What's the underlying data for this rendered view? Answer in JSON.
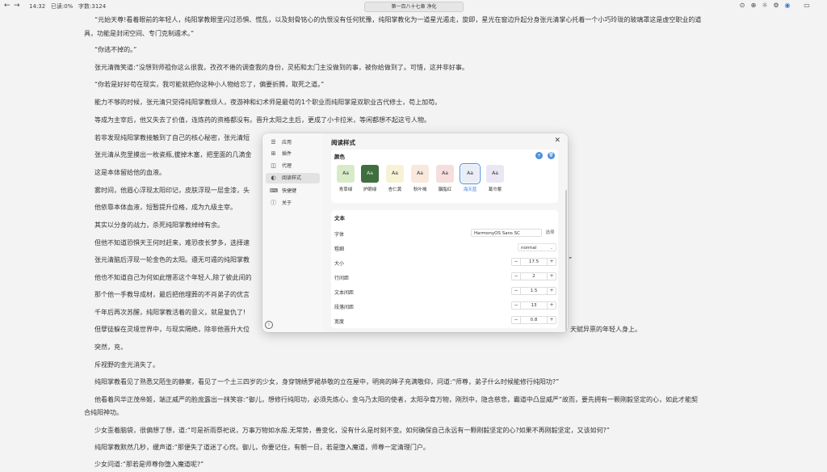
{
  "topbar": {
    "time": "14:32",
    "read_progress": "已读:0%",
    "word_count": "字数:3124",
    "chapter": "第一百八十七章 净化"
  },
  "paragraphs": [
    "“元始天尊!看着眼前的年轻人，纯阳掌教眼里闪过恐惧、慌乱，以及刻骨铭心的仇恨没有任何犹豫，纯阳掌教化为一道星光遁走，旋即，星光在窗边升起分身张元清掌心托着一个小巧玲珑的玻璃罩这是虚空职业的道",
    "具，功能是封闭空间、专门克制遁术。”",
    "“你逃不掉的。”",
    "张元清微笑道:“没想到师祖你这么很我，孜孜不倦的调查我的身份，灵拓和太门主没做到的事，被你给做到了。可惜，这并非好事。",
    "“你若是好好苟在现实，我可能就把你这种小人物给忘了，偏要折腾，取死之道。”",
    "能力不够的时候，张元清只觉得纯阳掌教烦人，夜游神和幻术师是最苟的1个职业而纯阳掌是双职业古代修士，苟上加苟。",
    "等成为主宰后，他又失去了价值，连炼药的资格都没有。晋升太阳之主后，更成了小卡拉米，等闲都想不起这号人物。",
    "若非发现纯阳掌教接触到了自己的核心秘密，张元清短",
    "张元清从兜里摸出一枚瓷瓶,拔掉木塞，把里面的几滴金",
    "这是本体留给他的血液。",
    "雾时间，他眉心浮现太阳印记，皮肤浮现一层金漆，头",
    "他依靠本体血液，短暂提升位格，成为九级主宰。",
    "其实以分身的战力，杀死纯阳掌教绰绰有余。",
    "但他不知道恐惧天王何时赶来，难恐夜长梦多，选择速",
    "张元清脑后浮现一轮金色的太阳。遵无可遁的纯阳掌教",
    "他也不知道自己为何如此憎恶这个年轻人,除了彼此间的",
    "那个他一手教导成材，最后把他埋葬的不肖弟子的优言",
    "千年后再次苏醒，纯阳掌教活着的意义，就是复仇了!",
    "但孽徒躲在灵境世界中，与现实隔绝，除非他晋升大位",
    "突然，充，",
    "斥视野的金光消失了。",
    "纯阳掌教看见了熟悉又陌生的静案，看见了一个土三四岁的少女，身穿锦绣罗裙恭敬的立在屋中，明亮的眸子充满敬仰，问道:“师尊，弟子什么时候能修行纯阳功?”",
    "他看着风华正茂帝姬，端正威严的脸庞露出一抹笑容:“御儿，想修行纯阳功，必须先炼心，金乌乃太阳的使者，太阳孕育万物，刚烈中，隐含慈悲，霸道中凸显威严”故而，要先拥有一颗刚毅坚定的心，如此才能契",
    "合纯阳神功。",
    "少女歪着脑袋，很偏想了想，道:“可是祈雨祭祀说，万事万物如水般.无常势，善变化，没有什么是时刻不变。如何确保自己永远有一颗刚毅坚定的心?如果不再刚毅坚定，又该如何?”",
    "纯阳掌教默然几秒，缓声道:“那便失了道迷了心窍。御儿，你要记住，有朝一日，若是堕入魔道，师尊一定清理门户。",
    "少女问道:“那若是师尊你堕入魔道呢?”"
  ],
  "para_tail": [
    {
      "text": "”",
      "row": 17
    },
    {
      "text": "天赋异禀的年轻人身上。",
      "row": 22
    }
  ],
  "sidebar": {
    "items": [
      {
        "icon": "☰",
        "icon_name": "app-icon",
        "label": "应用"
      },
      {
        "icon": "⊞",
        "icon_name": "plugin-icon",
        "label": "插件"
      },
      {
        "icon": "◫",
        "icon_name": "proxy-icon",
        "label": "代理"
      },
      {
        "icon": "◐",
        "icon_name": "palette-icon",
        "label": "阅读样式",
        "active": true
      },
      {
        "icon": "⌨",
        "icon_name": "keyboard-icon",
        "label": "快捷键"
      },
      {
        "icon": "ⓘ",
        "icon_name": "about-icon",
        "label": "关于"
      }
    ]
  },
  "dialog": {
    "title": "阅读样式",
    "color_section": {
      "title": "颜色",
      "add_icon": "+",
      "delete_icon": "🗑",
      "swatches": [
        {
          "sample": "Aa",
          "label": "青草绿",
          "bg": "#d8ebc9",
          "fg": "#333333"
        },
        {
          "sample": "Aa",
          "label": "护眼绿",
          "bg": "#3f6e3f",
          "fg": "#dfeede"
        },
        {
          "sample": "Aa",
          "label": "杏仁黄",
          "bg": "#f7f2d6",
          "fg": "#333333"
        },
        {
          "sample": "Aa",
          "label": "秋叶褐",
          "bg": "#f8e9dc",
          "fg": "#333333"
        },
        {
          "sample": "Aa",
          "label": "胭脂红",
          "bg": "#f6dede",
          "fg": "#333333"
        },
        {
          "sample": "Aa",
          "label": "海天蓝",
          "bg": "#e9edf5",
          "fg": "#333333",
          "selected": true
        },
        {
          "sample": "Aa",
          "label": "葛巾紫",
          "bg": "#ebe6f4",
          "fg": "#333333"
        }
      ]
    },
    "text_section": {
      "title": "文本",
      "font_label": "字体",
      "font_value": "HarmonyOS Sans SC",
      "font_button": "选择",
      "weight_label": "粗细",
      "weight_value": "normal",
      "steppers": [
        {
          "label": "大小",
          "value": "17.5"
        },
        {
          "label": "行间距",
          "value": "2"
        },
        {
          "label": "文本间距",
          "value": "1.5"
        },
        {
          "label": "段落间距",
          "value": "13"
        },
        {
          "label": "宽度",
          "value": "0.8"
        }
      ]
    },
    "close_icon": "✕"
  },
  "icons": {
    "back": "←",
    "forward": "→",
    "top_right": [
      "⊙",
      "⊕",
      "☼",
      "⚙",
      "◉",
      "▭",
      "—",
      "▢",
      "✕"
    ]
  },
  "colors": {
    "accent": "#4a8fe0",
    "page_bg": "#f3f3f3"
  }
}
